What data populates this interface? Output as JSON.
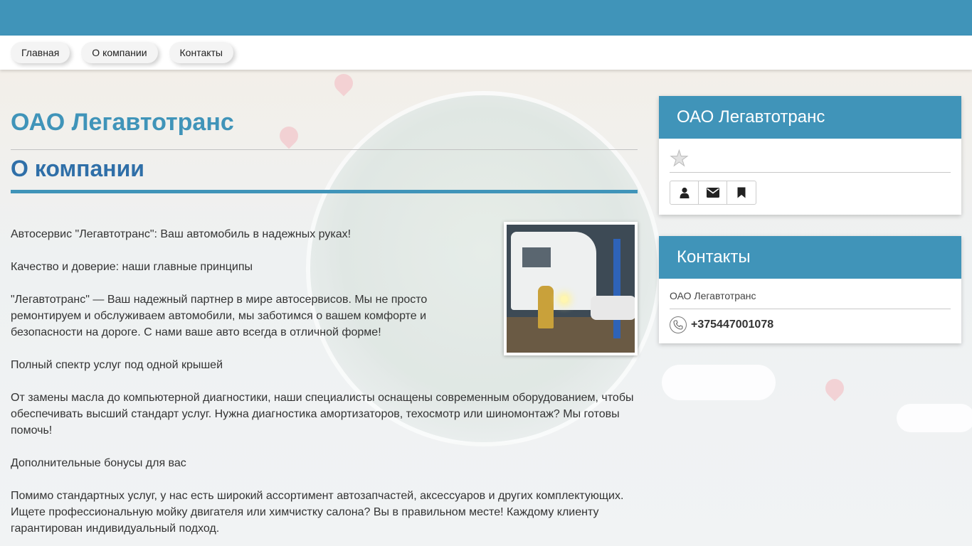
{
  "nav": {
    "items": [
      {
        "label": "Главная"
      },
      {
        "label": "О компании"
      },
      {
        "label": "Контакты"
      }
    ]
  },
  "main": {
    "company_title": "ОАО Легавтотранс",
    "section_title": "О компании",
    "paragraphs": [
      "Автосервис \"Легавтотранс\": Ваш автомобиль в надежных руках!",
      "Качество и доверие: наши главные принципы",
      "\"Легавтотранс\" — Ваш надежный партнер в мире автосервисов. Мы не просто ремонтируем и обслуживаем автомобили, мы заботимся о вашем комфорте и безопасности на дороге. С нами ваше авто всегда в отличной форме!",
      "Полный спектр услуг под одной крышей",
      "От замены масла до компьютерной диагностики, наши специалисты оснащены современным оборудованием, чтобы обеспечивать высший стандарт услуг. Нужна диагностика амортизаторов, техосмотр или шиномонтаж? Мы готовы помочь!",
      "Дополнительные бонусы для вас",
      "Помимо стандартных услуг, у нас есть широкий ассортимент автозапчастей, аксессуаров и других комплектующих. Ищете профессиональную мойку двигателя или химчистку салона? Вы в правильном месте! Каждому клиенту гарантирован индивидуальный подход."
    ]
  },
  "sidebar": {
    "company_card": {
      "title": "ОАО Легавтотранс",
      "rating_icon": "star-icon",
      "buttons": [
        {
          "icon": "user-icon"
        },
        {
          "icon": "envelope-icon"
        },
        {
          "icon": "bookmark-icon"
        }
      ]
    },
    "contacts_card": {
      "title": "Контакты",
      "company_name": "ОАО Легавтотранс",
      "phone": "+375447001078"
    }
  },
  "colors": {
    "accent": "#4094b9",
    "heading_blue": "#2f6fa8"
  }
}
